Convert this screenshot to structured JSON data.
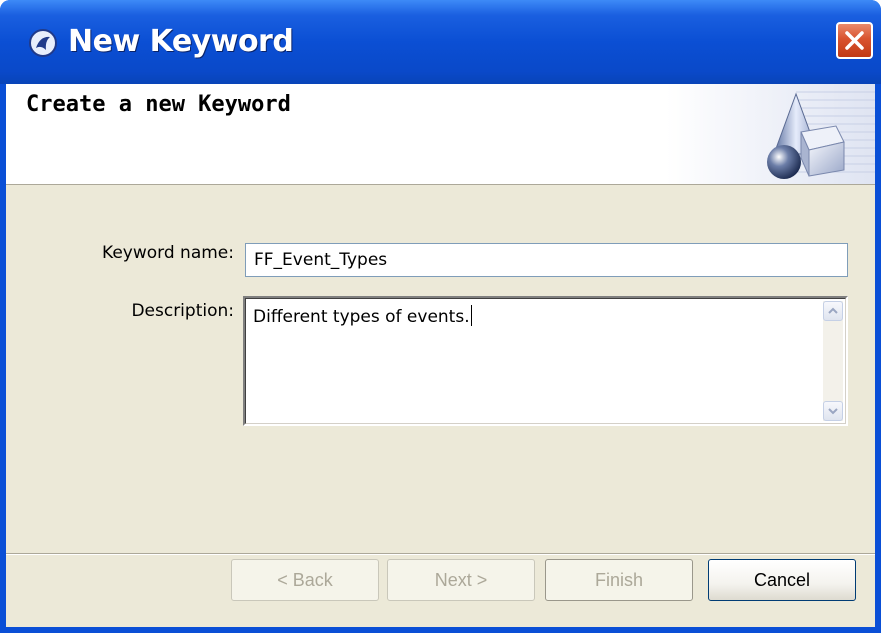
{
  "window": {
    "title": "New Keyword"
  },
  "banner": {
    "title": "Create a new Keyword"
  },
  "form": {
    "keyword_label": "Keyword name:",
    "keyword_value": "FF_Event_Types",
    "description_label": "Description:",
    "description_value": "Different types of events."
  },
  "buttons": {
    "back": "< Back",
    "next": "Next >",
    "finish": "Finish",
    "cancel": "Cancel"
  },
  "colors": {
    "titlebar": "#0a4fd6",
    "dialog_bg": "#ece9d8",
    "close_button": "#d9532f"
  },
  "icons": {
    "app": "wizard-app-icon",
    "close": "close-icon",
    "banner": "geometric-shapes-banner-icon",
    "scroll_up": "scroll-up-arrow-icon",
    "scroll_down": "scroll-down-arrow-icon"
  }
}
